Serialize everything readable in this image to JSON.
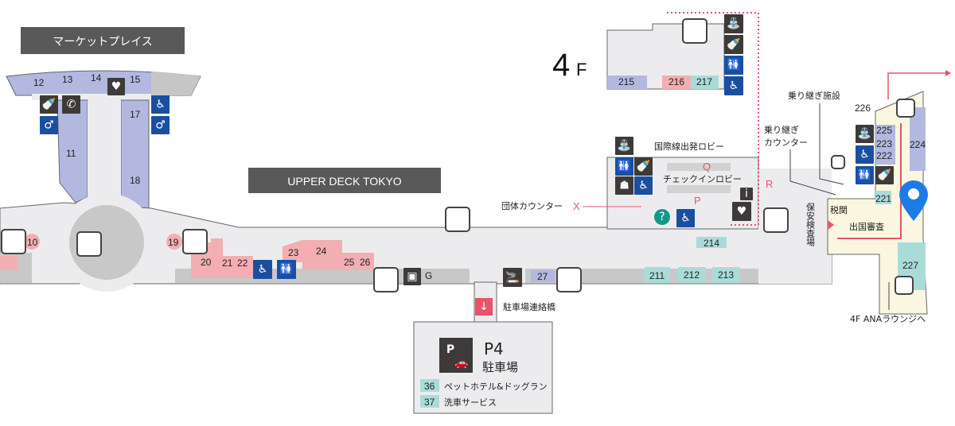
{
  "areas": {
    "marketplace": "マーケットプレイス",
    "upper_deck": "UPPER DECK TOKYO",
    "floor_big": "4",
    "floor_small": "F",
    "intl_departure_lobby": "国際線出発ロビー",
    "checkin_lobby": "チェックインロビー",
    "group_counter": "団体カウンター",
    "transfer_facility": "乗り継ぎ施設",
    "transfer_counter_1": "乗り継ぎ",
    "transfer_counter_2": "カウンター",
    "security_check": "保安検査場",
    "customs": "税関",
    "immigration": "出国審査",
    "ana_lounge": "4F ANAラウンジへ",
    "parking_bridge": "駐車場連絡橋",
    "parking_code": "P4",
    "parking_name": "駐車場"
  },
  "counters": {
    "Q": "Q",
    "P": "P",
    "R": "R",
    "X": "X",
    "G": "G"
  },
  "shops": {
    "s10": "10",
    "s11": "11",
    "s12": "12",
    "s13": "13",
    "s14": "14",
    "s15": "15",
    "s17": "17",
    "s18": "18",
    "s19": "19",
    "s20": "20",
    "s21": "21",
    "s22": "22",
    "s23": "23",
    "s24": "24",
    "s25": "25",
    "s26": "26",
    "s27": "27",
    "s211": "211",
    "s212": "212",
    "s213": "213",
    "s214": "214",
    "s215": "215",
    "s216": "216",
    "s217": "217",
    "s221": "221",
    "s222": "222",
    "s223": "223",
    "s224": "224",
    "s225": "225",
    "s226": "226",
    "s227": "227"
  },
  "parking_services": [
    {
      "number": "36",
      "name": "ペットホテル&ドッグラン"
    },
    {
      "number": "37",
      "name": "洗車サービス"
    }
  ],
  "colors": {
    "floor": "#ececee",
    "shop_lavender": "#b3b8e0",
    "shop_pink": "#f2aeb2",
    "shop_teal": "#a9dcd9",
    "restricted_area": "#fbf6e0",
    "facility_blue": "#1a4fa0",
    "facility_dark": "#3d3a39",
    "route_red": "#e8546b",
    "pin_blue": "#1c7ce6"
  },
  "icons": [
    "elevator-icon",
    "restroom-icon",
    "accessible-restroom-icon",
    "nursing-room-icon",
    "drinking-fountain-icon",
    "phone-icon",
    "aed-icon",
    "smoking-room-icon",
    "prayer-room-icon",
    "information-icon",
    "locker-icon",
    "parking-icon",
    "location-pin-icon"
  ]
}
